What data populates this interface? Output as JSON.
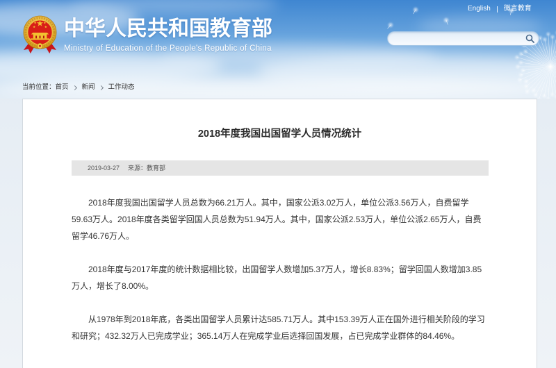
{
  "header": {
    "title": "中华人民共和国教育部",
    "subtitle": "Ministry of Education of the People's Republic of China",
    "emblem_icon": "national-emblem-icon",
    "top_links": [
      "English",
      "微言教育"
    ],
    "search": {
      "icon": "search-icon"
    }
  },
  "breadcrumb": {
    "label": "当前位置：",
    "items": [
      "首页",
      "新闻",
      "工作动态"
    ],
    "separator_icon": "chevron-right-icon"
  },
  "article": {
    "title": "2018年度我国出国留学人员情况统计",
    "date": "2019-03-27",
    "source": "来源：教育部",
    "paragraphs": [
      "2018年度我国出国留学人员总数为66.21万人。其中，国家公派3.02万人，单位公派3.56万人，自费留学59.63万人。2018年度各类留学回国人员总数为51.94万人。其中，国家公派2.53万人，单位公派2.65万人，自费留学46.76万人。",
      "2018年度与2017年度的统计数据相比较，出国留学人数增加5.37万人，增长8.83%；留学回国人数增加3.85万人，增长了8.00%。",
      "从1978年到2018年底，各类出国留学人员累计达585.71万人。其中153.39万人正在国外进行相关阶段的学习和研究；432.32万人已完成学业；365.14万人在完成学业后选择回国发展，占已完成学业群体的84.46%。"
    ]
  },
  "colors": {
    "sky_top": "#3f86d1",
    "sky_mid": "#69a5de",
    "sky_bottom": "#dde9f4",
    "header_text": "#ffffff",
    "body_text": "#333333",
    "panel_border": "#d3d9df",
    "meta_bg": "#e5e5e5",
    "emblem_red": "#d91e18",
    "emblem_gold": "#f2c230"
  }
}
